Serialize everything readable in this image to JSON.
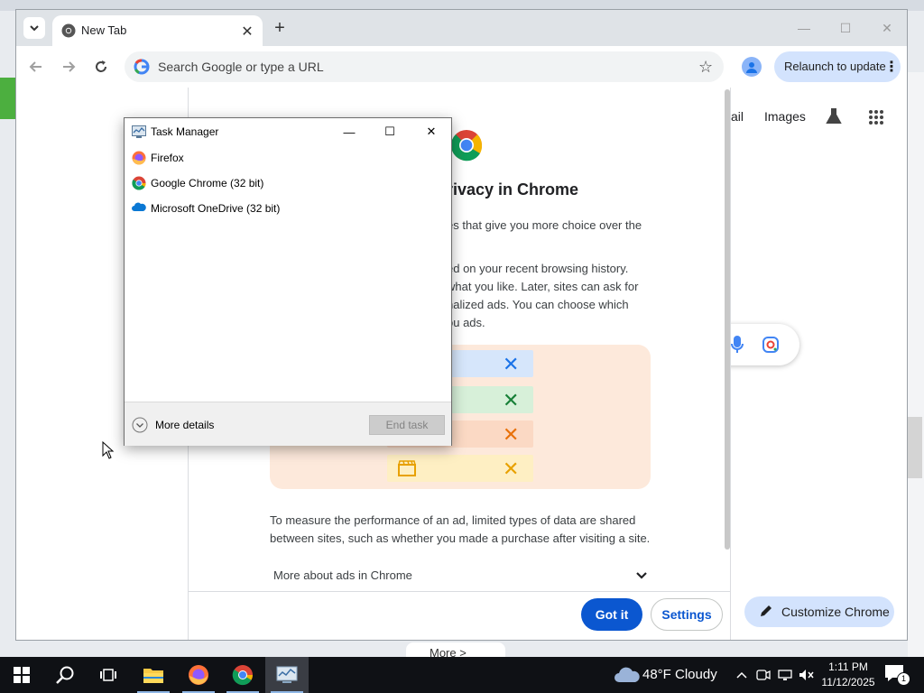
{
  "chrome": {
    "tab_title": "New Tab",
    "omnibox_placeholder": "Search Google or type a URL",
    "relaunch_label": "Relaunch to update",
    "ntp": {
      "gmail_label": "ail",
      "images_label": "Images",
      "customize_label": "Customize Chrome"
    },
    "privacy": {
      "heading": "rivacy in Chrome",
      "para1_lines": [
        "es that give you more choice over the"
      ],
      "para2_lines": [
        "ed on your recent browsing history.",
        "what you like. Later, sites can ask for",
        "nalized ads. You can choose which",
        "ou ads."
      ],
      "para3_lines": [
        "To measure the performance of an ad, limited types of data are shared",
        "between sites, such as whether you made a purchase after visiting a site."
      ],
      "more_label": "More about ads in Chrome",
      "got_it_label": "Got it",
      "settings_label": "Settings"
    }
  },
  "task_manager": {
    "title": "Task Manager",
    "apps": [
      {
        "name": "Firefox",
        "icon": "firefox-icon"
      },
      {
        "name": "Google Chrome (32 bit)",
        "icon": "chrome-icon"
      },
      {
        "name": "Microsoft OneDrive (32 bit)",
        "icon": "onedrive-icon"
      }
    ],
    "more_details_label": "More details",
    "end_task_label": "End task"
  },
  "desktop": {
    "bottom_peek_text": "More >"
  },
  "taskbar": {
    "weather_text": "48°F  Cloudy",
    "time": "1:11 PM",
    "date": "11/12/2025",
    "notification_count": "1"
  },
  "colors": {
    "accent_blue": "#0b57d0",
    "relaunch_bg": "#d3e3fd",
    "taskbar_bg": "#0f1115",
    "illustration_bg": "#fde9db"
  }
}
